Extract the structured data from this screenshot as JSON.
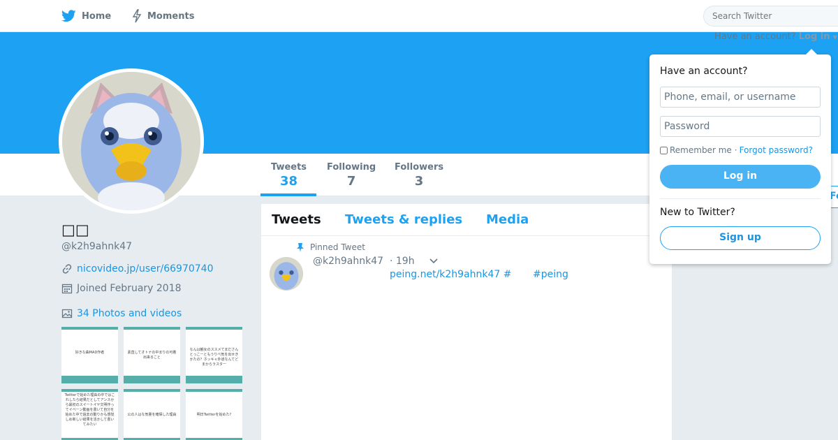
{
  "nav": {
    "home_label": "Home",
    "moments_label": "Moments",
    "search_placeholder": "Search Twitter"
  },
  "header": {
    "have_account_text": "Have an account?",
    "login_toggle_label": "Log in"
  },
  "profile": {
    "name": "□□",
    "handle": "@k2h9ahnk47",
    "website": "nicovideo.jp/user/66970740",
    "joined": "Joined February 2018",
    "photos_label": "34 Photos and videos"
  },
  "stats": [
    {
      "label": "Tweets",
      "value": "38"
    },
    {
      "label": "Following",
      "value": "7"
    },
    {
      "label": "Followers",
      "value": "3"
    }
  ],
  "follow_edge_label": "Fo",
  "thumbnails": [
    {
      "text": "好きな曲MAD作者"
    },
    {
      "text": "素直してオトナの中まりの可着出来ること"
    },
    {
      "text": "なんは観女のススメてまださんとっこーともうりべ気を出せきかたの？ホッキャ外道なんてどまからラスター"
    },
    {
      "text": "Twitterで始めた理由の中ではこれしたら結果だとしてアンスから最初のスイートイヤ文明作ってイベーン動画を書いて自分を始めた中で過去の動りかも感覚しめ新しい結果を活かして書いてみたい"
    },
    {
      "text": "公の人はな気量を確保した理由"
    },
    {
      "text": "明日Twitterを始めた?"
    }
  ],
  "timeline": {
    "tabs": [
      "Tweets",
      "Tweets & replies",
      "Media"
    ],
    "pinned_label": "Pinned Tweet",
    "tweet": {
      "handle": "@k2h9ahnk47",
      "time": "· 19h",
      "link1": "peing.net/k2h9ahnk47 #",
      "link2": "#peing"
    }
  },
  "login_box": {
    "title": "Have an account?",
    "username_placeholder": "Phone, email, or username",
    "password_placeholder": "Password",
    "remember_label": "Remember me",
    "separator": "·",
    "forgot_label": "Forgot password?",
    "login_button": "Log in",
    "new_label": "New to Twitter?",
    "signup_button": "Sign up"
  },
  "colors": {
    "banner": "#1da1f2",
    "accent": "#1b95e0",
    "login_button": "#4ab3f4",
    "thumb_accent": "#55aeaa"
  }
}
